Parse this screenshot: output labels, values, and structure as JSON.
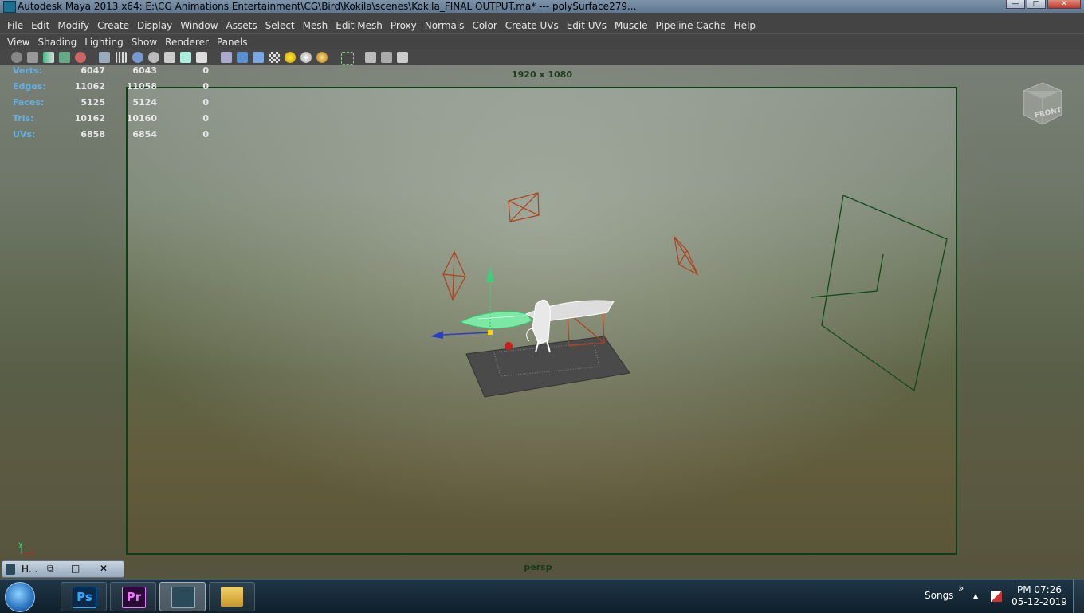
{
  "window": {
    "title": "Autodesk Maya 2013 x64: E:\\CG Animations Entertainment\\CG\\Bird\\Kokila\\scenes\\Kokila_FINAL OUTPUT.ma*   ---   polySurface279...",
    "min_label": "—",
    "max_label": "□",
    "close_label": "✕"
  },
  "menu": [
    "File",
    "Edit",
    "Modify",
    "Create",
    "Display",
    "Window",
    "Assets",
    "Select",
    "Mesh",
    "Edit Mesh",
    "Proxy",
    "Normals",
    "Color",
    "Create UVs",
    "Edit UVs",
    "Muscle",
    "Pipeline Cache",
    "Help"
  ],
  "panel_menu": [
    "View",
    "Shading",
    "Lighting",
    "Show",
    "Renderer",
    "Panels"
  ],
  "toolbar_icons": [
    "camera-attributes-icon",
    "bookmark-icon",
    "image-plane-icon",
    "grid-icon",
    "film-gate-icon",
    "resolution-gate-icon",
    "wireframe-icon",
    "smooth-shade-icon",
    "textured-icon",
    "lights-icon",
    "shadows-icon",
    "isolate-select-icon",
    "xray-icon",
    "xray-joints-icon",
    "xray-component-icon",
    "use-default-material-icon",
    "backface-culling-icon",
    "high-quality-icon"
  ],
  "hud": {
    "rows": [
      {
        "label": "Verts:",
        "a": "6047",
        "b": "6043",
        "c": "0"
      },
      {
        "label": "Edges:",
        "a": "11062",
        "b": "11058",
        "c": "0"
      },
      {
        "label": "Faces:",
        "a": "5125",
        "b": "5124",
        "c": "0"
      },
      {
        "label": "Tris:",
        "a": "10162",
        "b": "10160",
        "c": "0"
      },
      {
        "label": "UVs:",
        "a": "6858",
        "b": "6854",
        "c": "0"
      }
    ],
    "resolution": "1920 x 1080",
    "camera": "persp",
    "viewcube_label": "FRONT",
    "axis_y": "y",
    "axis_x": "x"
  },
  "minimized": {
    "label": "H...",
    "restore_label": "⧉",
    "max_label": "□",
    "close_label": "✕"
  },
  "taskbar": {
    "items": [
      {
        "name": "photoshop",
        "label": "Ps",
        "color": "#0b2a4a",
        "text_color": "#31a8ff"
      },
      {
        "name": "premiere",
        "label": "Pr",
        "color": "#2a0b36",
        "text_color": "#ea77ff"
      },
      {
        "name": "maya",
        "label": "",
        "color": "#2b4b5a",
        "text_color": "#ffffff"
      },
      {
        "name": "explorer",
        "label": "",
        "color": "#d8a93a",
        "text_color": "#000000"
      }
    ],
    "tray_label": "Songs",
    "tray_chevron": "»",
    "tray_arrow": "▲",
    "time": "PM 07:26",
    "date": "05-12-2019"
  }
}
